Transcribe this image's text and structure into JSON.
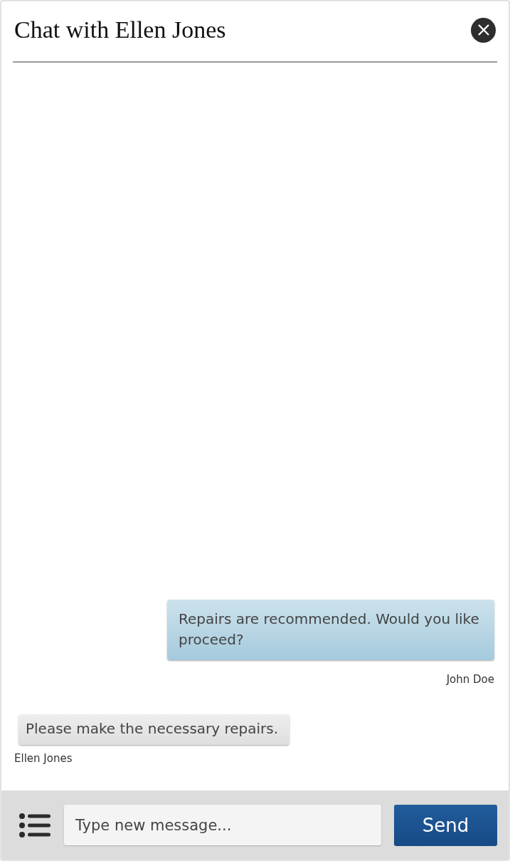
{
  "window": {
    "title": "Chat with Ellen Jones"
  },
  "messages": [
    {
      "kind": "outgoing",
      "text": "Repairs are recommended. Would you like proceed?",
      "sender": "John Doe"
    },
    {
      "kind": "incoming",
      "text": "Please make the necessary repairs.",
      "sender": "Ellen Jones"
    }
  ],
  "composer": {
    "placeholder": "Type new message...",
    "send_label": "Send"
  }
}
